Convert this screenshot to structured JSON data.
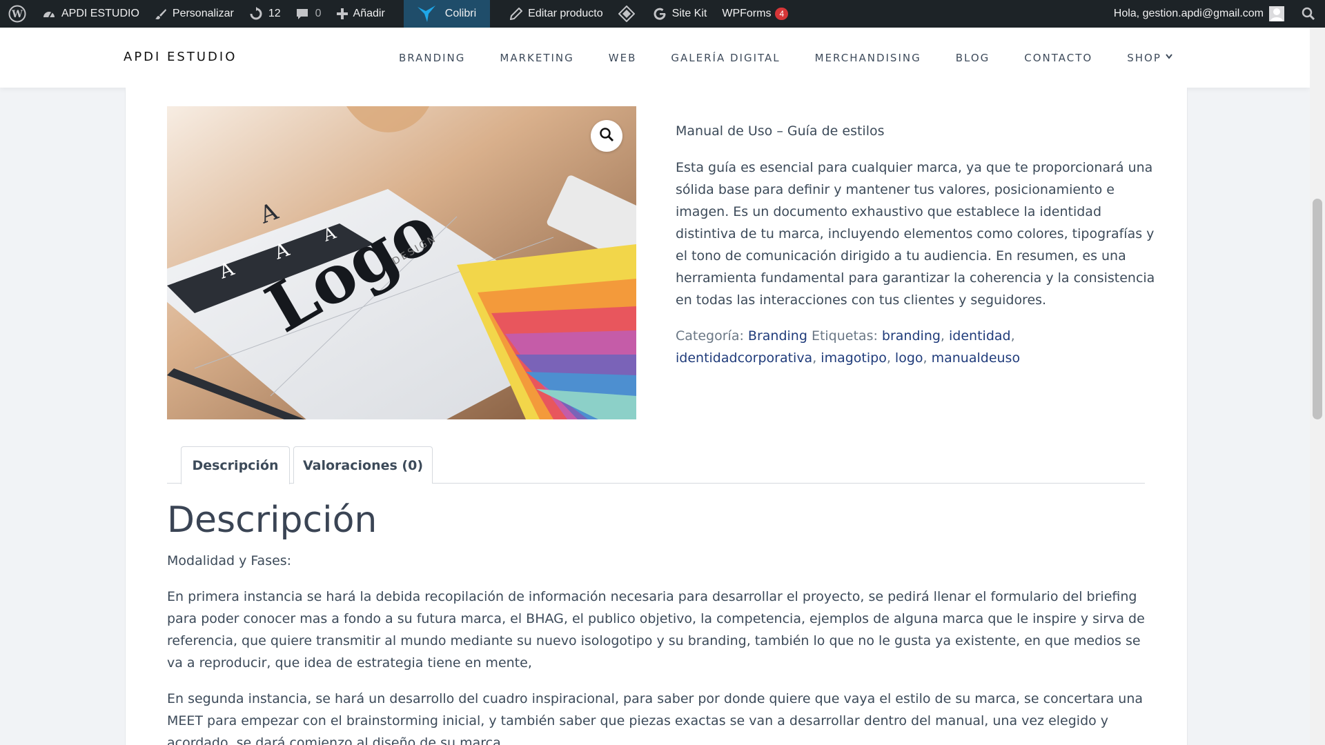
{
  "admin_bar": {
    "site_name": "APDI ESTUDIO",
    "customize": "Personalizar",
    "updates_count": "12",
    "comments_count": "0",
    "add_new": "Añadir",
    "colibri": "Colibri",
    "edit_product": "Editar producto",
    "site_kit": "Site Kit",
    "wpforms": "WPForms",
    "wpforms_badge": "4",
    "greeting": "Hola, gestion.apdi@gmail.com"
  },
  "header": {
    "logo": "APDI ESTUDIO",
    "nav": [
      "BRANDING",
      "MARKETING",
      "WEB",
      "GALERÍA DIGITAL",
      "MERCHANDISING",
      "BLOG",
      "CONTACTO",
      "SHOP"
    ]
  },
  "product": {
    "image_text": {
      "logo_word": "Logo",
      "design_word": "DESIGN",
      "letter": "A"
    },
    "title": "Manual de Uso – Guía de estilos",
    "description": "Esta guía es esencial para cualquier marca, ya que te proporcionará una sólida base para definir y mantener tus valores, posicionamiento e imagen. Es un documento exhaustivo que establece la identidad distintiva de tu marca, incluyendo elementos como colores, tipografías y el tono de comunicación dirigido a tu audiencia. En resumen, es una herramienta fundamental para garantizar la coherencia y la consistencia en todas las interacciones con tus clientes y seguidores.",
    "category_label": "Categoría:",
    "category": "Branding",
    "tags_label": "Etiquetas:",
    "tags": [
      "branding",
      "identidad",
      "identidadcorporativa",
      "imagotipo",
      "logo",
      "manualdeuso"
    ]
  },
  "tabs": {
    "description": "Descripción",
    "reviews": "Valoraciones (0)"
  },
  "description_section": {
    "heading": "Descripción",
    "subtitle": "Modalidad y Fases:",
    "paragraph1": "En primera instancia se hará la debida recopilación de información necesaria para desarrollar el proyecto, se pedirá llenar el formulario del briefing para poder conocer mas a fondo a su futura marca, el BHAG, el publico objetivo, la competencia, ejemplos de alguna marca que le inspire y sirva de referencia, que quiere transmitir al mundo mediante su nuevo isologotipo y su branding, también lo que no le gusta ya existente, en que medios se va a reproducir, que idea de estrategia tiene en mente,",
    "paragraph2": "En segunda instancia, se hará un desarrollo del cuadro inspiracional, para saber por donde quiere que vaya el estilo de su marca, se concertara una MEET  para empezar con el brainstorming inicial, y también saber que piezas exactas se van a desarrollar dentro del manual, una vez elegido y acordado, se dará comienzo al diseño de su marca."
  },
  "colors": {
    "admin_bar": "#1d2327",
    "link": "#1f3b7a",
    "text": "#3c4a59",
    "badge": "#d63638"
  }
}
